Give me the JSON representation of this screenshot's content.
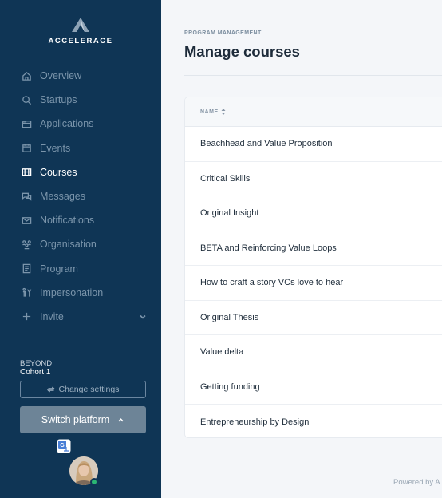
{
  "brand": {
    "name": "ACCELERACE"
  },
  "sidebar": {
    "items": [
      {
        "label": "Overview",
        "icon": "home-icon"
      },
      {
        "label": "Startups",
        "icon": "search-icon"
      },
      {
        "label": "Applications",
        "icon": "folder-icon"
      },
      {
        "label": "Events",
        "icon": "calendar-icon"
      },
      {
        "label": "Courses",
        "icon": "courses-icon",
        "active": true
      },
      {
        "label": "Messages",
        "icon": "messages-icon"
      },
      {
        "label": "Notifications",
        "icon": "mail-icon"
      },
      {
        "label": "Organisation",
        "icon": "organisation-icon"
      },
      {
        "label": "Program",
        "icon": "program-icon"
      },
      {
        "label": "Impersonation",
        "icon": "impersonation-icon"
      },
      {
        "label": "Invite",
        "icon": "plus-icon"
      }
    ],
    "org_name": "BEYOND",
    "cohort": "Cohort 1",
    "change_settings_label": "Change settings",
    "switch_platform_label": "Switch platform"
  },
  "header": {
    "eyebrow": "PROGRAM MANAGEMENT",
    "title": "Manage courses"
  },
  "table": {
    "column_header": "NAME",
    "rows": [
      "Beachhead and Value Proposition",
      "Critical Skills",
      "Original Insight",
      "BETA and Reinforcing Value Loops",
      "How to craft a story VCs love to hear",
      "Original Thesis",
      "Value delta",
      "Getting funding",
      "Entrepreneurship by Design"
    ]
  },
  "footer": {
    "powered_by": "Powered by A"
  },
  "colors": {
    "sidebar_bg": "#0f3555",
    "accent_status": "#2bb673",
    "switch_button": "#6d8497"
  }
}
